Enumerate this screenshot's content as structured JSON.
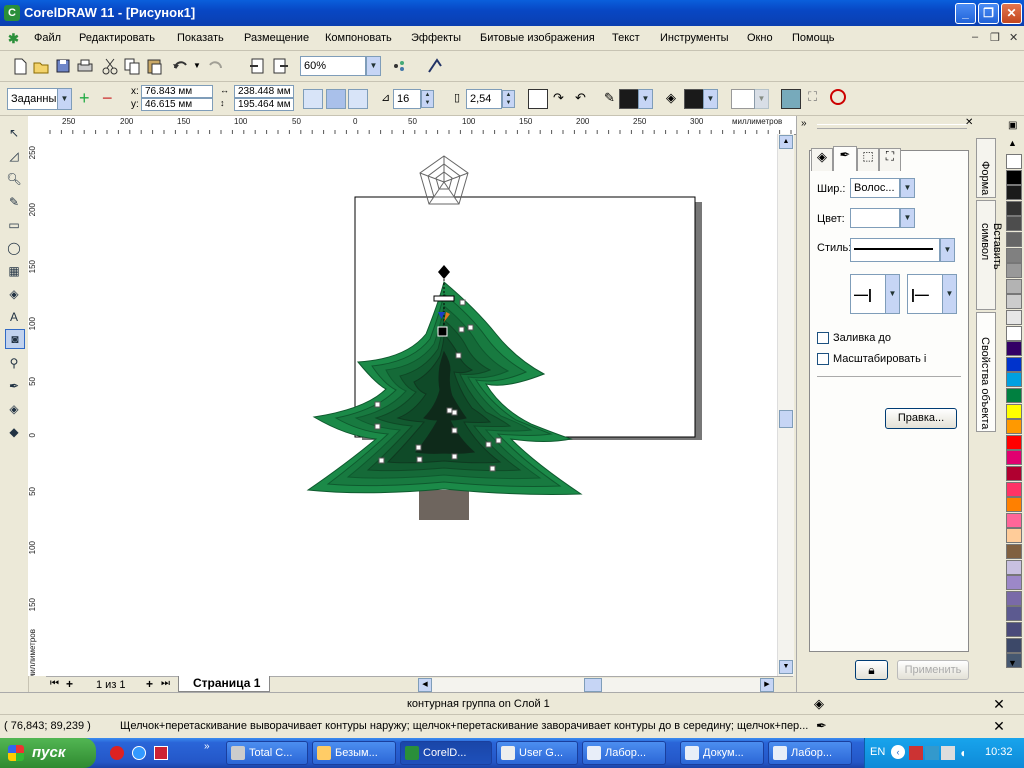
{
  "window": {
    "title": "CorelDRAW 11 - [Рисунок1]",
    "app_icon_letter": "C"
  },
  "menu": [
    "Файл",
    "Редактировать",
    "Показать",
    "Размещение",
    "Компоновать",
    "Эффекты",
    "Битовые изображения",
    "Текст",
    "Инструменты",
    "Окно",
    "Помощь"
  ],
  "standard_toolbar": {
    "zoom": "60%"
  },
  "property_bar": {
    "preset": "Заданны",
    "x": "76.843 мм",
    "y": "46.615 мм",
    "width": "238.448 мм",
    "height": "195.464 мм",
    "steps": "16",
    "offset": "2,54"
  },
  "rulers": {
    "unit": "миллиметров",
    "h_ticks": [
      "250",
      "200",
      "150",
      "100",
      "50",
      "0",
      "50",
      "100",
      "150",
      "200",
      "250",
      "300"
    ],
    "v_ticks": [
      "250",
      "200",
      "150",
      "100",
      "50",
      "0",
      "50",
      "100",
      "150"
    ]
  },
  "page_nav": {
    "page_count": "1 из 1",
    "page_tab": "Страница 1"
  },
  "docker": {
    "width_label": "Шир.:",
    "width_value": "Волос...",
    "color_label": "Цвет:",
    "style_label": "Стиль:",
    "fill_behind": "Заливка до",
    "scale_with": "Масштабировать і",
    "edit_button": "Правка...",
    "apply_button": "Применить"
  },
  "docker_tabs": [
    "Форма",
    "Вставить символ",
    "Свойства объекта"
  ],
  "palette": [
    "#ffffff",
    "#000000",
    "#1a1a1a",
    "#333333",
    "#4d4d4d",
    "#666666",
    "#808080",
    "#999999",
    "#b3b3b3",
    "#cccccc",
    "#e6e6e6",
    "#ffffff",
    "#330066",
    "#0033cc",
    "#00a0e0",
    "#008040",
    "#ffff00",
    "#ff9900",
    "#ff0000",
    "#e00070",
    "#b00030",
    "#ff3366",
    "#ff8000",
    "#ff6699",
    "#ffcc99",
    "#806040",
    "#c8c0e0",
    "#9c88c8",
    "#7a6aa8",
    "#5c5a90",
    "#4a4a7a",
    "#3c4868",
    "#465870"
  ],
  "status": {
    "selection": "контурная группа on Слой 1",
    "coords": "( 76,843; 89,239 )",
    "hint": "Щелчок+перетаскивание выворачивает контуры наружу; щелчок+перетаскивание  заворачивает контуры до в середину; щелчок+пер..."
  },
  "taskbar": {
    "start": "пуск",
    "tasks": [
      "Total C...",
      "Безым...",
      "CorelD...",
      "User G...",
      "Лабор...",
      "Докум...",
      "Лабор..."
    ],
    "lang": "EN",
    "clock": "10:32"
  },
  "colors": {
    "tree": "#1b8a48",
    "tree_dark": "#0e2a1a",
    "trunk": "#6e655e",
    "selection": "#0a246a"
  }
}
